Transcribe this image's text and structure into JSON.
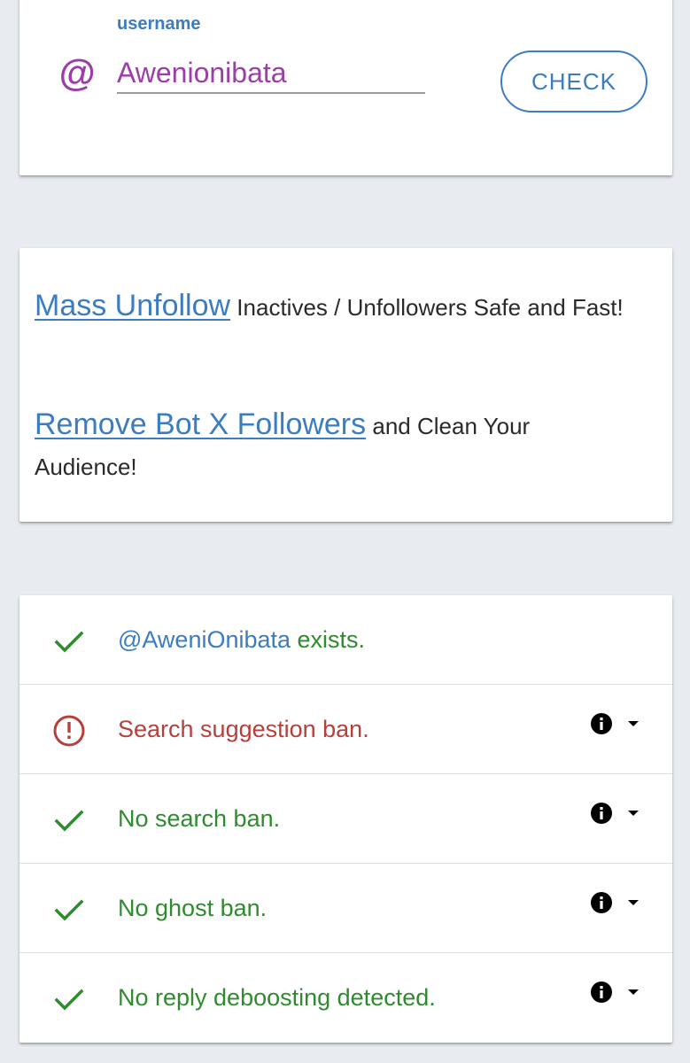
{
  "search": {
    "label": "username",
    "at_symbol": "@",
    "value": "Awenionibata",
    "check_label": "CHECK"
  },
  "promo": {
    "items": [
      {
        "link": "Mass Unfollow",
        "text": " Inactives / Unfollowers Safe and Fast!"
      },
      {
        "link": "Remove Bot X Followers",
        "text": " and Clean Your Audience!"
      }
    ]
  },
  "results": {
    "handle": "@AweniOnibata",
    "exists_text": " exists.",
    "rows": [
      {
        "text": "Search suggestion ban.",
        "status": "warning",
        "icon": "alert-circle-icon"
      },
      {
        "text": "No search ban.",
        "status": "ok",
        "icon": "check-icon"
      },
      {
        "text": "No ghost ban.",
        "status": "ok",
        "icon": "check-icon"
      },
      {
        "text": "No reply deboosting detected.",
        "status": "ok",
        "icon": "check-icon"
      }
    ]
  },
  "colors": {
    "background": "#e8ebef",
    "accent_blue": "#3b7dc0",
    "username_purple": "#9b3ea8",
    "ok_green": "#2e8b2e",
    "warning_red": "#b5403c"
  }
}
